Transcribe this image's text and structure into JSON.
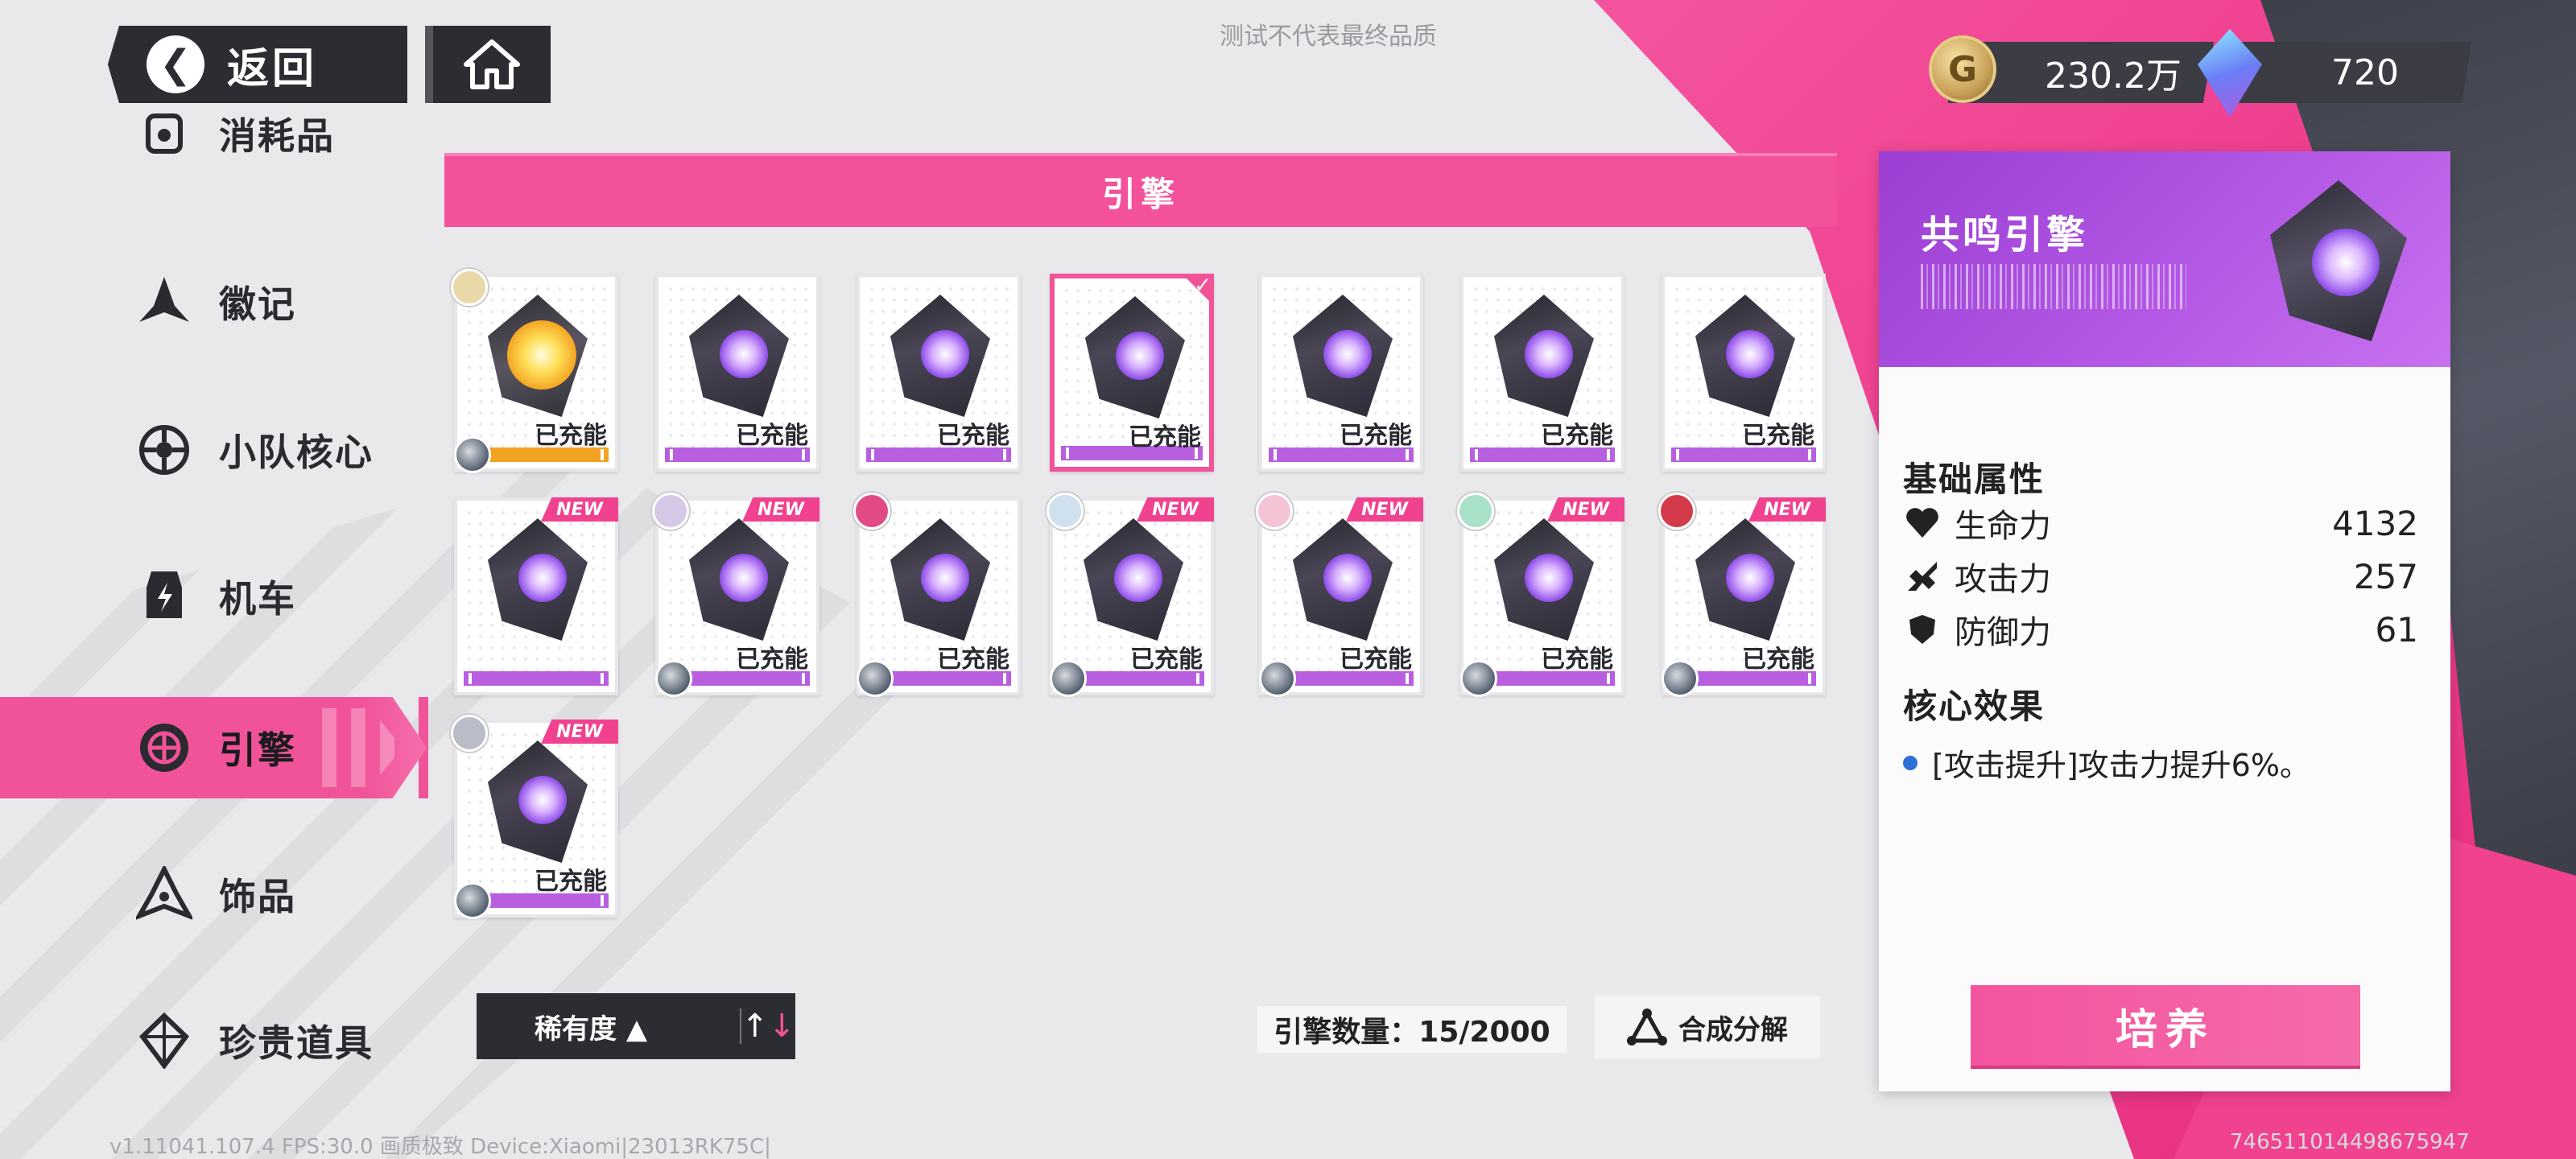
{
  "top": {
    "back_label": "返回",
    "watermark": "测试不代表最终品质",
    "gold_amount": "230.2万",
    "gem_amount": "720"
  },
  "sidebar": {
    "items": [
      {
        "label": "消耗品",
        "icon": "consumable-icon",
        "active": false
      },
      {
        "label": "徽记",
        "icon": "emblem-icon",
        "active": false
      },
      {
        "label": "小队核心",
        "icon": "squad-core-icon",
        "active": false
      },
      {
        "label": "机车",
        "icon": "motorcycle-icon",
        "active": false
      },
      {
        "label": "引擎",
        "icon": "engine-icon",
        "active": true
      },
      {
        "label": "饰品",
        "icon": "accessory-icon",
        "active": false
      },
      {
        "label": "珍贵道具",
        "icon": "precious-item-icon",
        "active": false
      }
    ]
  },
  "category_title": "引擎",
  "cards": [
    {
      "status": "已充能",
      "new": false,
      "type": "gold",
      "selected": false
    },
    {
      "status": "已充能",
      "new": false,
      "type": "purple",
      "selected": false
    },
    {
      "status": "已充能",
      "new": false,
      "type": "purple",
      "selected": false
    },
    {
      "status": "已充能",
      "new": false,
      "type": "purple",
      "selected": true
    },
    {
      "status": "已充能",
      "new": false,
      "type": "purple",
      "selected": false
    },
    {
      "status": "已充能",
      "new": false,
      "type": "purple",
      "selected": false
    },
    {
      "status": "已充能",
      "new": false,
      "type": "purple",
      "selected": false
    },
    {
      "status": "",
      "new": true,
      "type": "purple",
      "selected": false
    },
    {
      "status": "已充能",
      "new": true,
      "type": "purple",
      "selected": false
    },
    {
      "status": "已充能",
      "new": false,
      "type": "purple",
      "selected": false
    },
    {
      "status": "已充能",
      "new": true,
      "type": "purple",
      "selected": false
    },
    {
      "status": "已充能",
      "new": true,
      "type": "purple",
      "selected": false
    },
    {
      "status": "已充能",
      "new": true,
      "type": "purple",
      "selected": false
    },
    {
      "status": "已充能",
      "new": true,
      "type": "purple",
      "selected": false
    },
    {
      "status": "已充能",
      "new": true,
      "type": "purple",
      "selected": false
    }
  ],
  "new_tag": "NEW",
  "sort": {
    "label": "稀有度 ▲"
  },
  "engine_count": "引擎数量：15/2000",
  "combine_label": "合成分解",
  "detail": {
    "title": "共鸣引擎",
    "base_attr_title": "基础属性",
    "stats": [
      {
        "name": "生命力",
        "value": "4132",
        "icon": "heart-icon"
      },
      {
        "name": "攻击力",
        "value": "257",
        "icon": "attack-icon"
      },
      {
        "name": "防御力",
        "value": "61",
        "icon": "shield-icon"
      }
    ],
    "core_effect_title": "核心效果",
    "core_effect": "[攻击提升]攻击力提升6%。",
    "cultivate_label": "培养"
  },
  "footer": {
    "left": "v1.11041.107.4 FPS:30.0 画质极致 Device:Xiaomi|23013RK75C|",
    "right": "746511014498675947"
  },
  "colors": {
    "accent": "#f15399",
    "panel_dark": "#2c2d33",
    "purple": "#b357e5"
  }
}
